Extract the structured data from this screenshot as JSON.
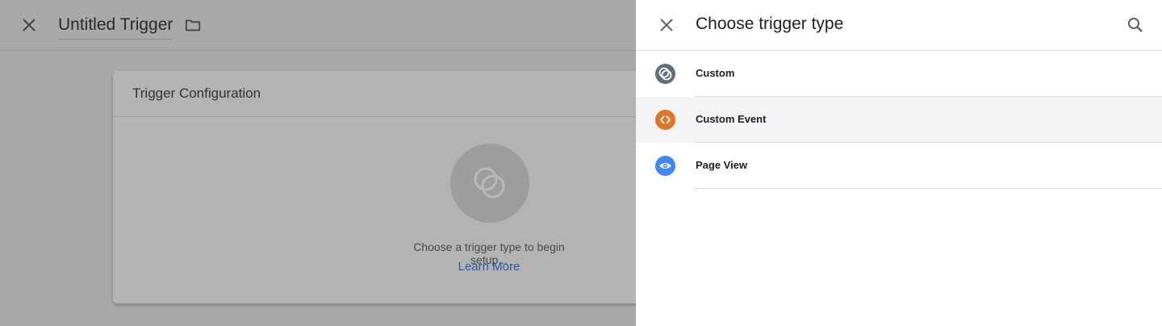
{
  "editor": {
    "trigger_name": "Untitled Trigger",
    "config_title": "Trigger Configuration",
    "hint": "Choose a trigger type to begin setup...",
    "learn_more": "Learn More"
  },
  "panel": {
    "title": "Choose trigger type",
    "items": [
      {
        "label": "Custom",
        "icon": "custom-trigger-icon",
        "color": "#5f6f7a",
        "selected": false
      },
      {
        "label": "Custom Event",
        "icon": "code-brackets-icon",
        "color": "#e37526",
        "selected": true
      },
      {
        "label": "Page View",
        "icon": "eye-icon",
        "color": "#4285f4",
        "selected": false
      }
    ]
  },
  "colors": {
    "accent_link": "#2c5aa6",
    "selected_row": "#f1f3f4"
  }
}
